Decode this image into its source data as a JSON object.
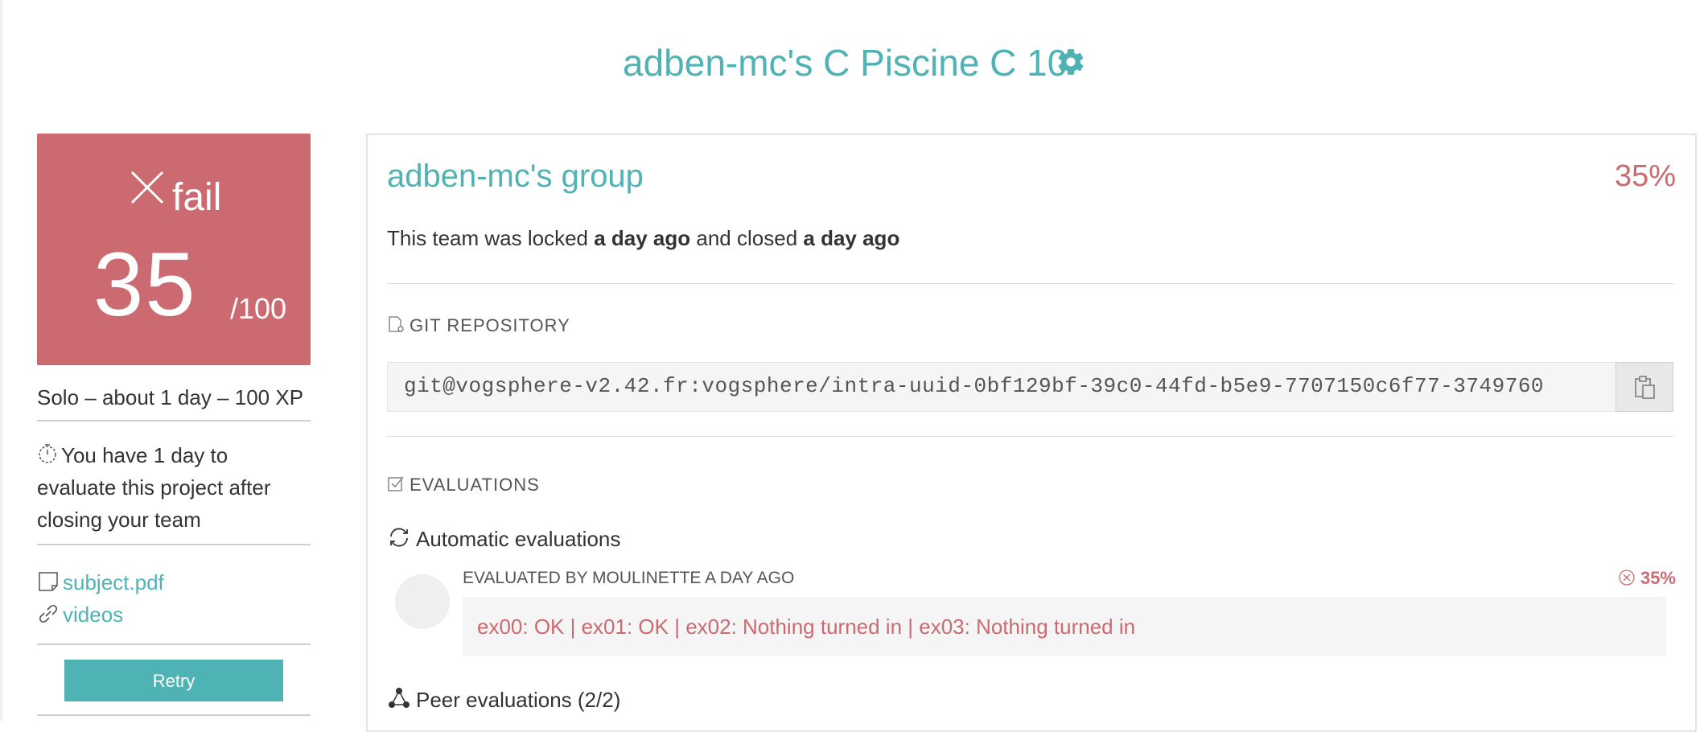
{
  "header": {
    "title": "adben-mc's C Piscine C 10",
    "settings_icon": "gear-icon"
  },
  "grade_card": {
    "status_icon": "close-icon",
    "status": "fail",
    "score": "35",
    "max": "/100",
    "color": "#cb6a70"
  },
  "project": {
    "meta": "Solo – about 1 day – 100 XP",
    "deadline_icon": "stopwatch-icon",
    "deadline": "You have 1 day to evaluate this project after closing your team",
    "links": [
      {
        "icon": "document-icon",
        "label": "subject.pdf"
      },
      {
        "icon": "link-icon",
        "label": "videos"
      }
    ],
    "retry_label": "Retry"
  },
  "team": {
    "name": "adben-mc's group",
    "percent": "35%",
    "lock_prefix": "This team was locked",
    "locked_when": "a day ago",
    "lock_middle": "and closed",
    "closed_when": "a day ago"
  },
  "git": {
    "label": "GIT REPOSITORY",
    "url": "git@vogsphere-v2.42.fr:vogsphere/intra-uuid-0bf129bf-39c0-44fd-b5e9-7707150c6f77-3749760",
    "copy_icon": "clipboard-icon"
  },
  "evaluations": {
    "label": "EVALUATIONS",
    "automatic": {
      "title": "Automatic evaluations",
      "evaluated_by": "EVALUATED BY MOULINETTE A DAY AGO",
      "score": "35%",
      "result": "ex00: OK | ex01: OK | ex02: Nothing turned in | ex03: Nothing turned in"
    },
    "peer": {
      "title": "Peer evaluations (2/2)"
    }
  },
  "colors": {
    "accent": "#4fb3b5",
    "fail": "#cb6a70"
  }
}
